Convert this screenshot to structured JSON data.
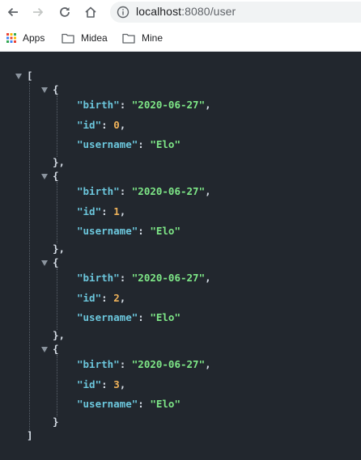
{
  "browser": {
    "url_host": "localhost",
    "url_path": ":8080/user",
    "bookmarks": [
      {
        "label": "Apps",
        "icon": "apps-grid-icon"
      },
      {
        "label": "Midea",
        "icon": "folder-icon"
      },
      {
        "label": "Mine",
        "icon": "folder-icon"
      }
    ]
  },
  "json_view": {
    "open_bracket": "[",
    "close_bracket": "]",
    "open_brace": "{",
    "close_brace_comma": "},",
    "close_brace": "}",
    "quote": "\"",
    "colon": ": ",
    "comma": ",",
    "items": [
      {
        "birth": "2020-06-27",
        "id": "0",
        "username": "Elo"
      },
      {
        "birth": "2020-06-27",
        "id": "1",
        "username": "Elo"
      },
      {
        "birth": "2020-06-27",
        "id": "2",
        "username": "Elo"
      },
      {
        "birth": "2020-06-27",
        "id": "3",
        "username": "Elo"
      }
    ],
    "keys": {
      "birth": "birth",
      "id": "id",
      "username": "username"
    }
  },
  "colors": {
    "background": "#22272e",
    "key": "#6cc7dd",
    "string": "#7ee787",
    "number": "#f0b35a"
  }
}
